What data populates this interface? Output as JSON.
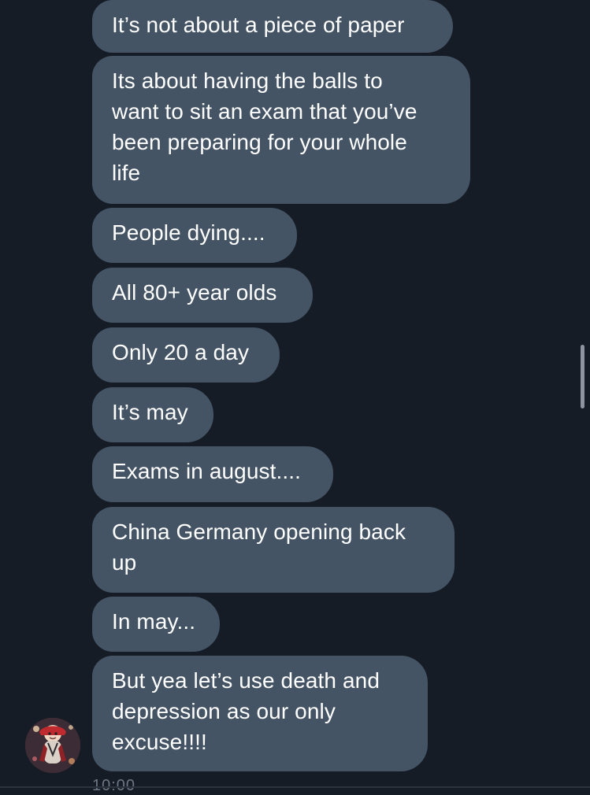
{
  "messages": [
    {
      "text": "It’s not about a piece of paper"
    },
    {
      "text": "Its about having the balls to\nwant to sit an exam that you’ve\nbeen preparing for your whole\nlife"
    },
    {
      "text": "People dying...."
    },
    {
      "text": "All 80+ year olds"
    },
    {
      "text": "Only 20 a day"
    },
    {
      "text": "It’s may"
    },
    {
      "text": "Exams in august...."
    },
    {
      "text": "China Germany opening back\nup"
    },
    {
      "text": "In may..."
    },
    {
      "text": "But yea let’s use death and\ndepression as our only\nexcuse!!!!"
    }
  ],
  "timestamp": "10:00",
  "colors": {
    "background": "#151c26",
    "bubble": "#445465",
    "text": "#ffffff"
  }
}
